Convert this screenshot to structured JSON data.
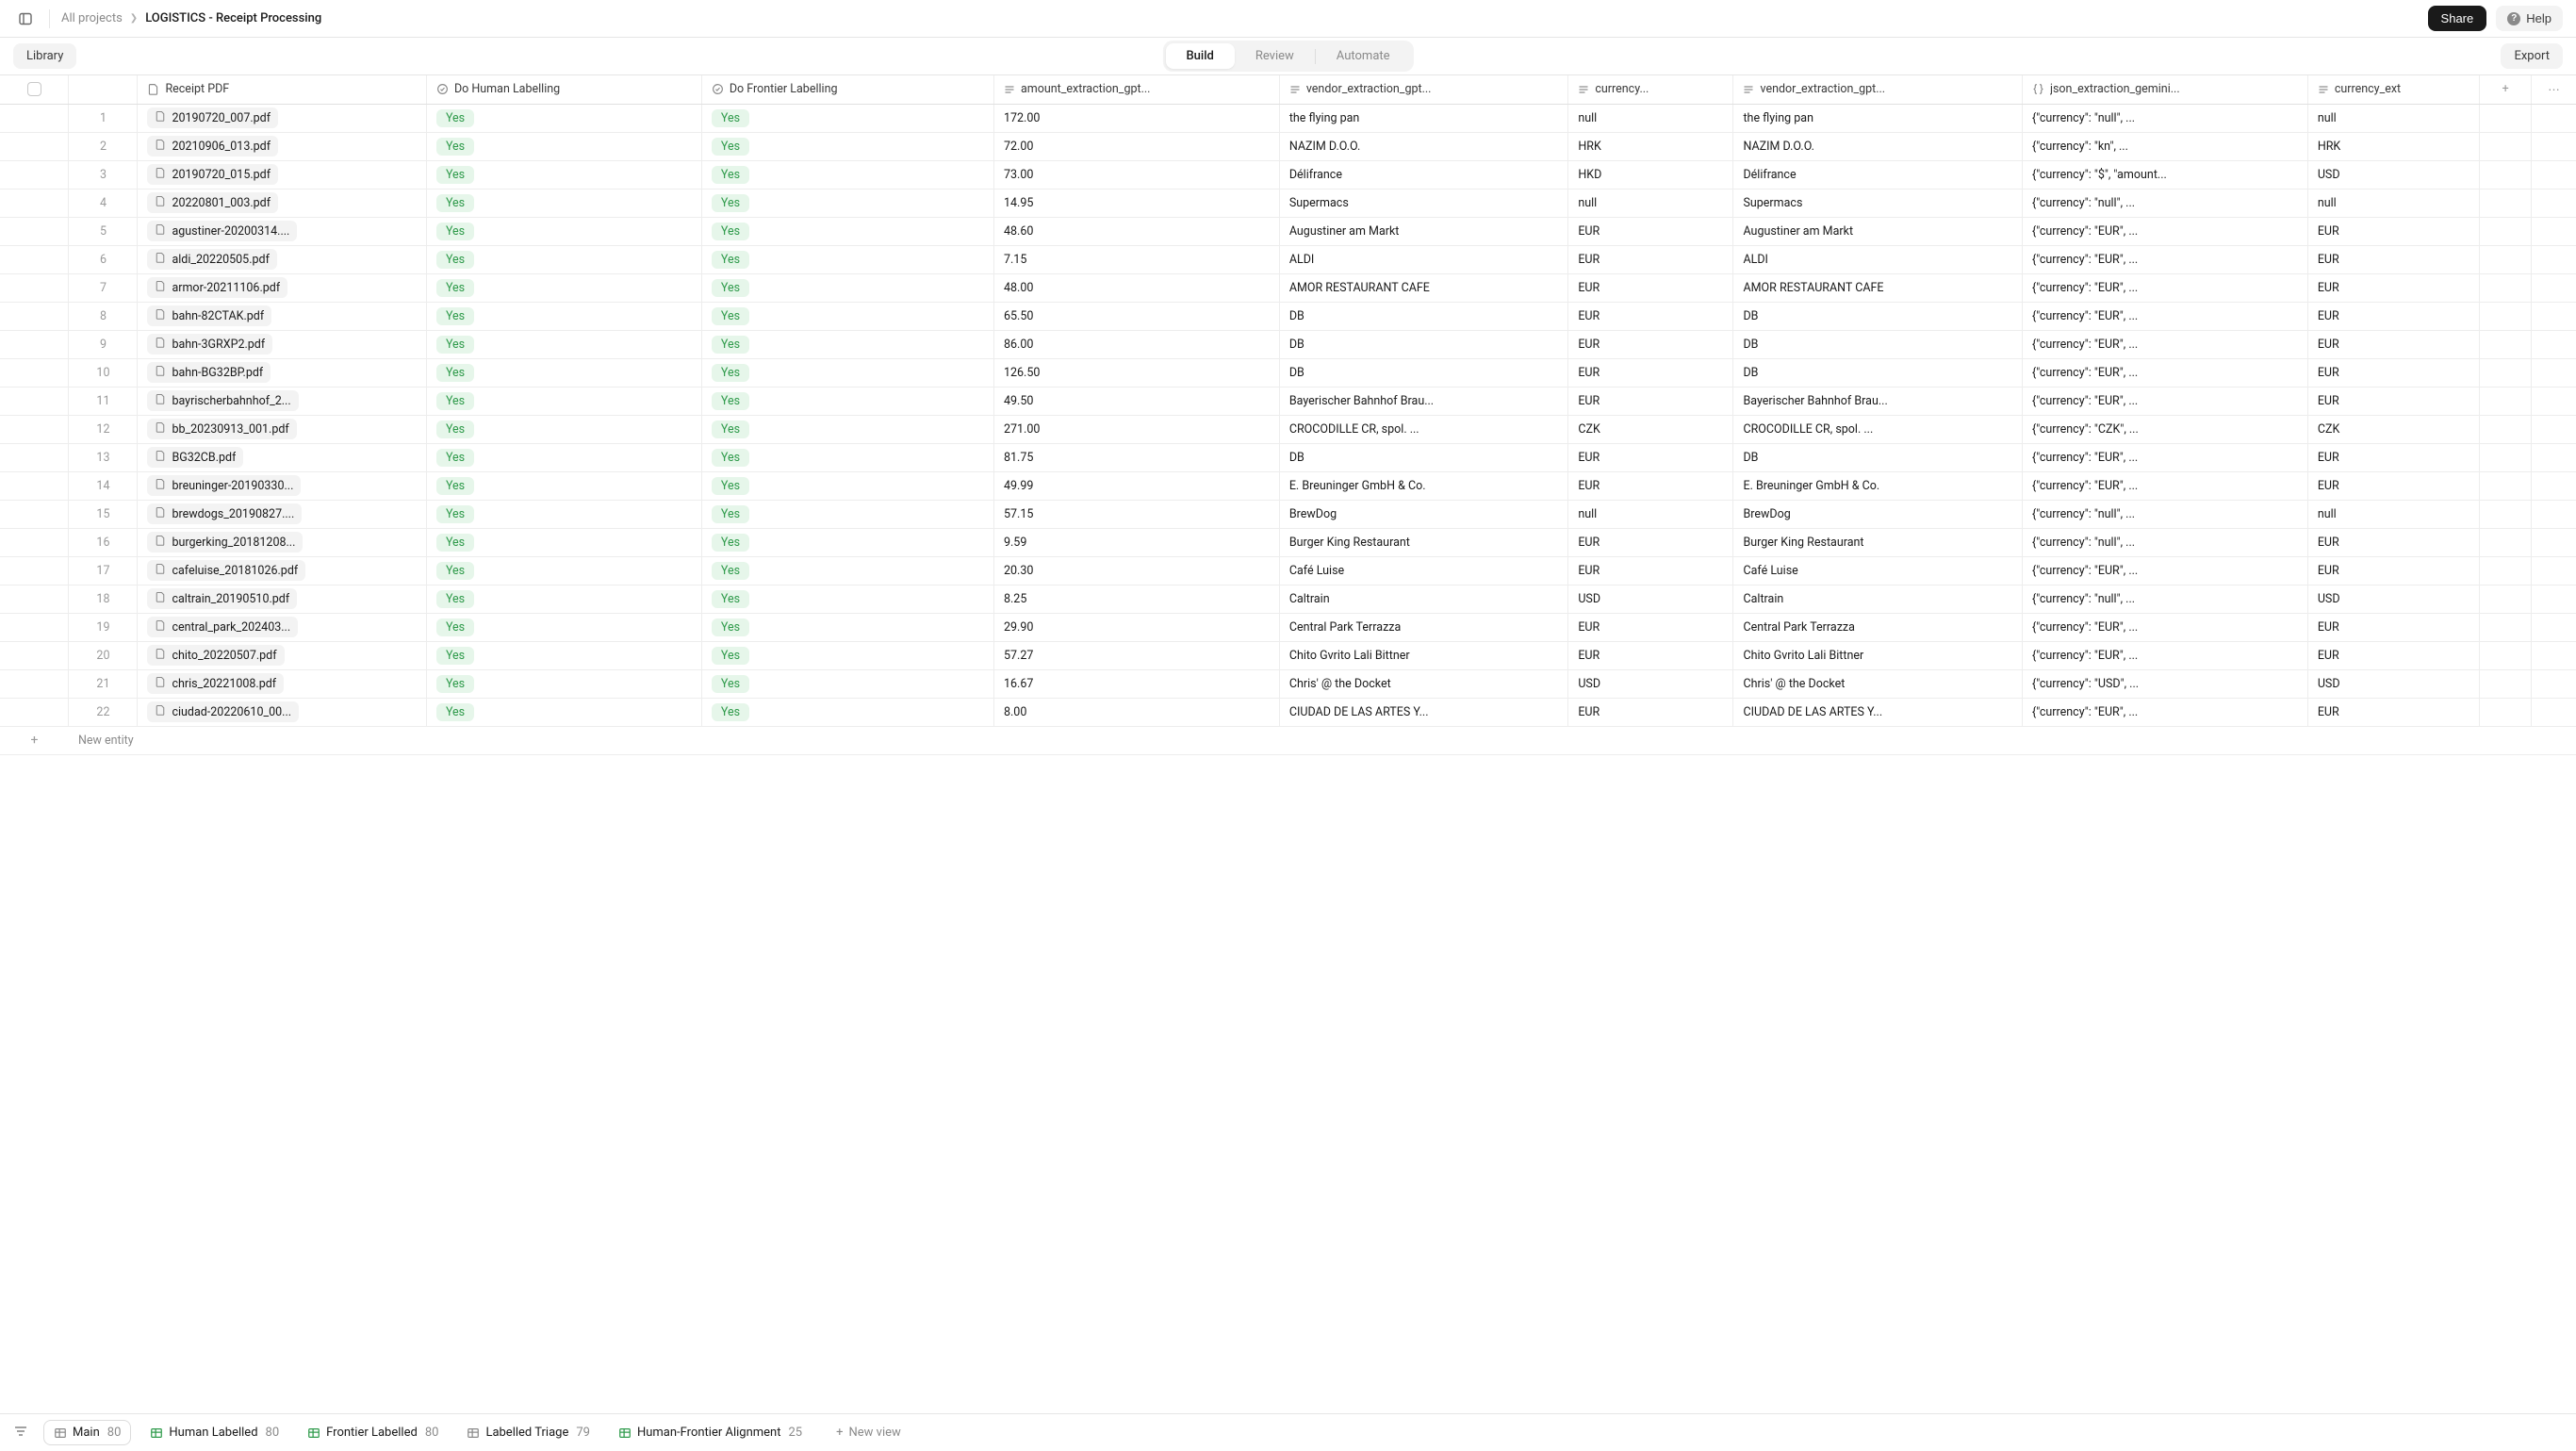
{
  "topbar": {
    "all_projects": "All projects",
    "project_name": "LOGISTICS - Receipt Processing",
    "share": "Share",
    "help": "Help"
  },
  "secondbar": {
    "library": "Library",
    "build": "Build",
    "review": "Review",
    "automate": "Automate",
    "export": "Export"
  },
  "columns": {
    "receipt": "Receipt PDF",
    "human": "Do Human Labelling",
    "frontier": "Do Frontier Labelling",
    "amount": "amount_extraction_gpt...",
    "vendor1": "vendor_extraction_gpt...",
    "currency1": "currency...",
    "vendor2": "vendor_extraction_gpt...",
    "json": "json_extraction_gemini...",
    "currency2": "currency_ext"
  },
  "yes_label": "Yes",
  "rows": [
    {
      "n": "1",
      "file": "20190720_007.pdf",
      "amount": "172.00",
      "vendor1": "the flying pan",
      "curr1": "null",
      "vendor2": "the flying pan",
      "json": "{\"currency\": \"null\", ...",
      "curr2": "null"
    },
    {
      "n": "2",
      "file": "20210906_013.pdf",
      "amount": "72.00",
      "vendor1": "NAZIM D.O.O.",
      "curr1": "HRK",
      "vendor2": "NAZIM D.O.O.",
      "json": "{\"currency\": \"kn\", ...",
      "curr2": "HRK"
    },
    {
      "n": "3",
      "file": "20190720_015.pdf",
      "amount": "73.00",
      "vendor1": "Délifrance",
      "curr1": "HKD",
      "vendor2": "Délifrance",
      "json": "{\"currency\": \"$\", \"amount...",
      "curr2": "USD"
    },
    {
      "n": "4",
      "file": "20220801_003.pdf",
      "amount": "14.95",
      "vendor1": "Supermacs",
      "curr1": "null",
      "vendor2": "Supermacs",
      "json": "{\"currency\": \"null\", ...",
      "curr2": "null"
    },
    {
      "n": "5",
      "file": "agustiner-20200314....",
      "amount": "48.60",
      "vendor1": "Augustiner am Markt",
      "curr1": "EUR",
      "vendor2": "Augustiner am Markt",
      "json": "{\"currency\": \"EUR\", ...",
      "curr2": "EUR"
    },
    {
      "n": "6",
      "file": "aldi_20220505.pdf",
      "amount": "7.15",
      "vendor1": "ALDI",
      "curr1": "EUR",
      "vendor2": "ALDI",
      "json": "{\"currency\": \"EUR\", ...",
      "curr2": "EUR"
    },
    {
      "n": "7",
      "file": "armor-20211106.pdf",
      "amount": "48.00",
      "vendor1": "AMOR RESTAURANT CAFE",
      "curr1": "EUR",
      "vendor2": "AMOR RESTAURANT CAFE",
      "json": "{\"currency\": \"EUR\", ...",
      "curr2": "EUR"
    },
    {
      "n": "8",
      "file": "bahn-82CTAK.pdf",
      "amount": "65.50",
      "vendor1": "DB",
      "curr1": "EUR",
      "vendor2": "DB",
      "json": "{\"currency\": \"EUR\", ...",
      "curr2": "EUR"
    },
    {
      "n": "9",
      "file": "bahn-3GRXP2.pdf",
      "amount": "86.00",
      "vendor1": "DB",
      "curr1": "EUR",
      "vendor2": "DB",
      "json": "{\"currency\": \"EUR\", ...",
      "curr2": "EUR"
    },
    {
      "n": "10",
      "file": "bahn-BG32BP.pdf",
      "amount": "126.50",
      "vendor1": "DB",
      "curr1": "EUR",
      "vendor2": "DB",
      "json": "{\"currency\": \"EUR\", ...",
      "curr2": "EUR"
    },
    {
      "n": "11",
      "file": "bayrischerbahnhof_2...",
      "amount": "49.50",
      "vendor1": "Bayerischer Bahnhof Brau...",
      "curr1": "EUR",
      "vendor2": "Bayerischer Bahnhof Brau...",
      "json": "{\"currency\": \"EUR\", ...",
      "curr2": "EUR"
    },
    {
      "n": "12",
      "file": "bb_20230913_001.pdf",
      "amount": "271.00",
      "vendor1": "CROCODILLE CR, spol. ...",
      "curr1": "CZK",
      "vendor2": "CROCODILLE CR, spol. ...",
      "json": "{\"currency\": \"CZK\", ...",
      "curr2": "CZK"
    },
    {
      "n": "13",
      "file": "BG32CB.pdf",
      "amount": "81.75",
      "vendor1": "DB",
      "curr1": "EUR",
      "vendor2": "DB",
      "json": "{\"currency\": \"EUR\", ...",
      "curr2": "EUR"
    },
    {
      "n": "14",
      "file": "breuninger-20190330...",
      "amount": "49.99",
      "vendor1": "E. Breuninger GmbH & Co.",
      "curr1": "EUR",
      "vendor2": "E. Breuninger GmbH & Co.",
      "json": "{\"currency\": \"EUR\", ...",
      "curr2": "EUR"
    },
    {
      "n": "15",
      "file": "brewdogs_20190827....",
      "amount": "57.15",
      "vendor1": "BrewDog",
      "curr1": "null",
      "vendor2": "BrewDog",
      "json": "{\"currency\": \"null\", ...",
      "curr2": "null"
    },
    {
      "n": "16",
      "file": "burgerking_20181208...",
      "amount": "9.59",
      "vendor1": "Burger King Restaurant",
      "curr1": "EUR",
      "vendor2": "Burger King Restaurant",
      "json": "{\"currency\": \"null\", ...",
      "curr2": "EUR"
    },
    {
      "n": "17",
      "file": "cafeluise_20181026.pdf",
      "amount": "20.30",
      "vendor1": "Café Luise",
      "curr1": "EUR",
      "vendor2": "Café Luise",
      "json": "{\"currency\": \"EUR\", ...",
      "curr2": "EUR"
    },
    {
      "n": "18",
      "file": "caltrain_20190510.pdf",
      "amount": "8.25",
      "vendor1": "Caltrain",
      "curr1": "USD",
      "vendor2": "Caltrain",
      "json": "{\"currency\": \"null\", ...",
      "curr2": "USD"
    },
    {
      "n": "19",
      "file": "central_park_202403...",
      "amount": "29.90",
      "vendor1": "Central Park Terrazza",
      "curr1": "EUR",
      "vendor2": "Central Park Terrazza",
      "json": "{\"currency\": \"EUR\", ...",
      "curr2": "EUR"
    },
    {
      "n": "20",
      "file": "chito_20220507.pdf",
      "amount": "57.27",
      "vendor1": "Chito Gvrito Lali Bittner",
      "curr1": "EUR",
      "vendor2": "Chito Gvrito Lali Bittner",
      "json": "{\"currency\": \"EUR\", ...",
      "curr2": "EUR"
    },
    {
      "n": "21",
      "file": "chris_20221008.pdf",
      "amount": "16.67",
      "vendor1": "Chris' @ the Docket",
      "curr1": "USD",
      "vendor2": "Chris' @ the Docket",
      "json": "{\"currency\": \"USD\", ...",
      "curr2": "USD"
    },
    {
      "n": "22",
      "file": "ciudad-20220610_00...",
      "amount": "8.00",
      "vendor1": "CIUDAD DE LAS ARTES Y...",
      "curr1": "EUR",
      "vendor2": "CIUDAD DE LAS ARTES Y...",
      "json": "{\"currency\": \"EUR\", ...",
      "curr2": "EUR"
    }
  ],
  "new_entity": "New entity",
  "footer": {
    "views": [
      {
        "label": "Main",
        "count": "80",
        "active": true,
        "icon": "table"
      },
      {
        "label": "Human Labelled",
        "count": "80",
        "active": false,
        "icon": "table-green"
      },
      {
        "label": "Frontier Labelled",
        "count": "80",
        "active": false,
        "icon": "table-green"
      },
      {
        "label": "Labelled Triage",
        "count": "79",
        "active": false,
        "icon": "table"
      },
      {
        "label": "Human-Frontier Alignment",
        "count": "25",
        "active": false,
        "icon": "table-green"
      }
    ],
    "new_view": "New view"
  }
}
